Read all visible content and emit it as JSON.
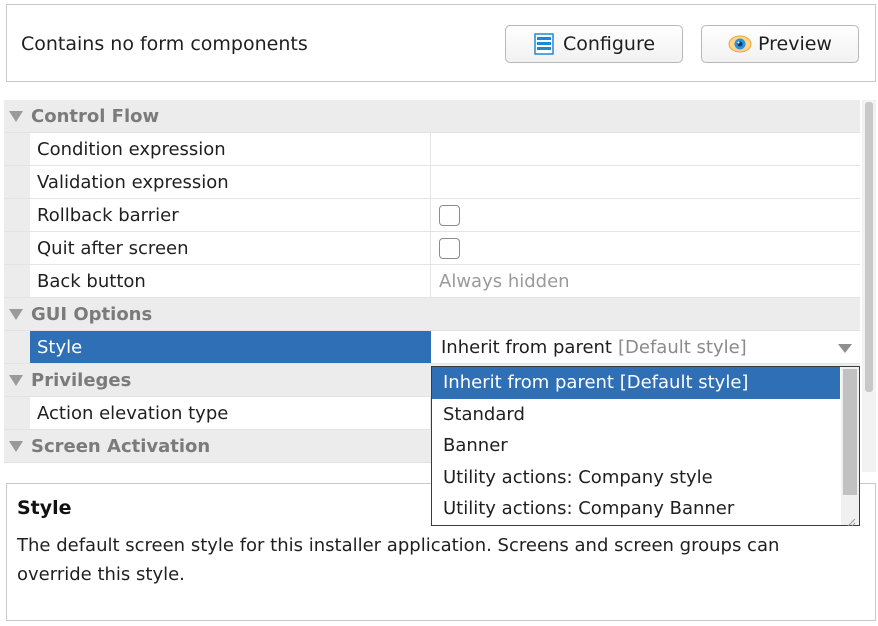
{
  "header": {
    "message": "Contains no form components",
    "configure_label": "Configure",
    "preview_label": "Preview"
  },
  "sections": {
    "control_flow": "Control Flow",
    "gui_options": "GUI Options",
    "privileges": "Privileges",
    "screen_activation": "Screen Activation"
  },
  "properties": {
    "condition_expression": {
      "label": "Condition expression",
      "value": ""
    },
    "validation_expression": {
      "label": "Validation expression",
      "value": ""
    },
    "rollback_barrier": {
      "label": "Rollback barrier",
      "checked": false
    },
    "quit_after_screen": {
      "label": "Quit after screen",
      "checked": false
    },
    "back_button": {
      "label": "Back button",
      "value": "Always hidden"
    },
    "style": {
      "label": "Style",
      "value": "Inherit from parent",
      "default_hint": "[Default style]"
    },
    "action_elevation_type": {
      "label": "Action elevation type",
      "value": ""
    }
  },
  "style_dropdown": {
    "options": [
      "Inherit from parent [Default style]",
      "Standard",
      "Banner",
      "Utility actions: Company style",
      "Utility actions: Company Banner"
    ],
    "selected_index": 0
  },
  "help": {
    "title": "Style",
    "description": "The default screen style for this installer application. Screens and screen groups can override this style."
  },
  "colors": {
    "selection": "#2f6fb6",
    "section_bg": "#ececec",
    "section_text": "#7b7b7b",
    "muted_text": "#9a9a9a"
  }
}
